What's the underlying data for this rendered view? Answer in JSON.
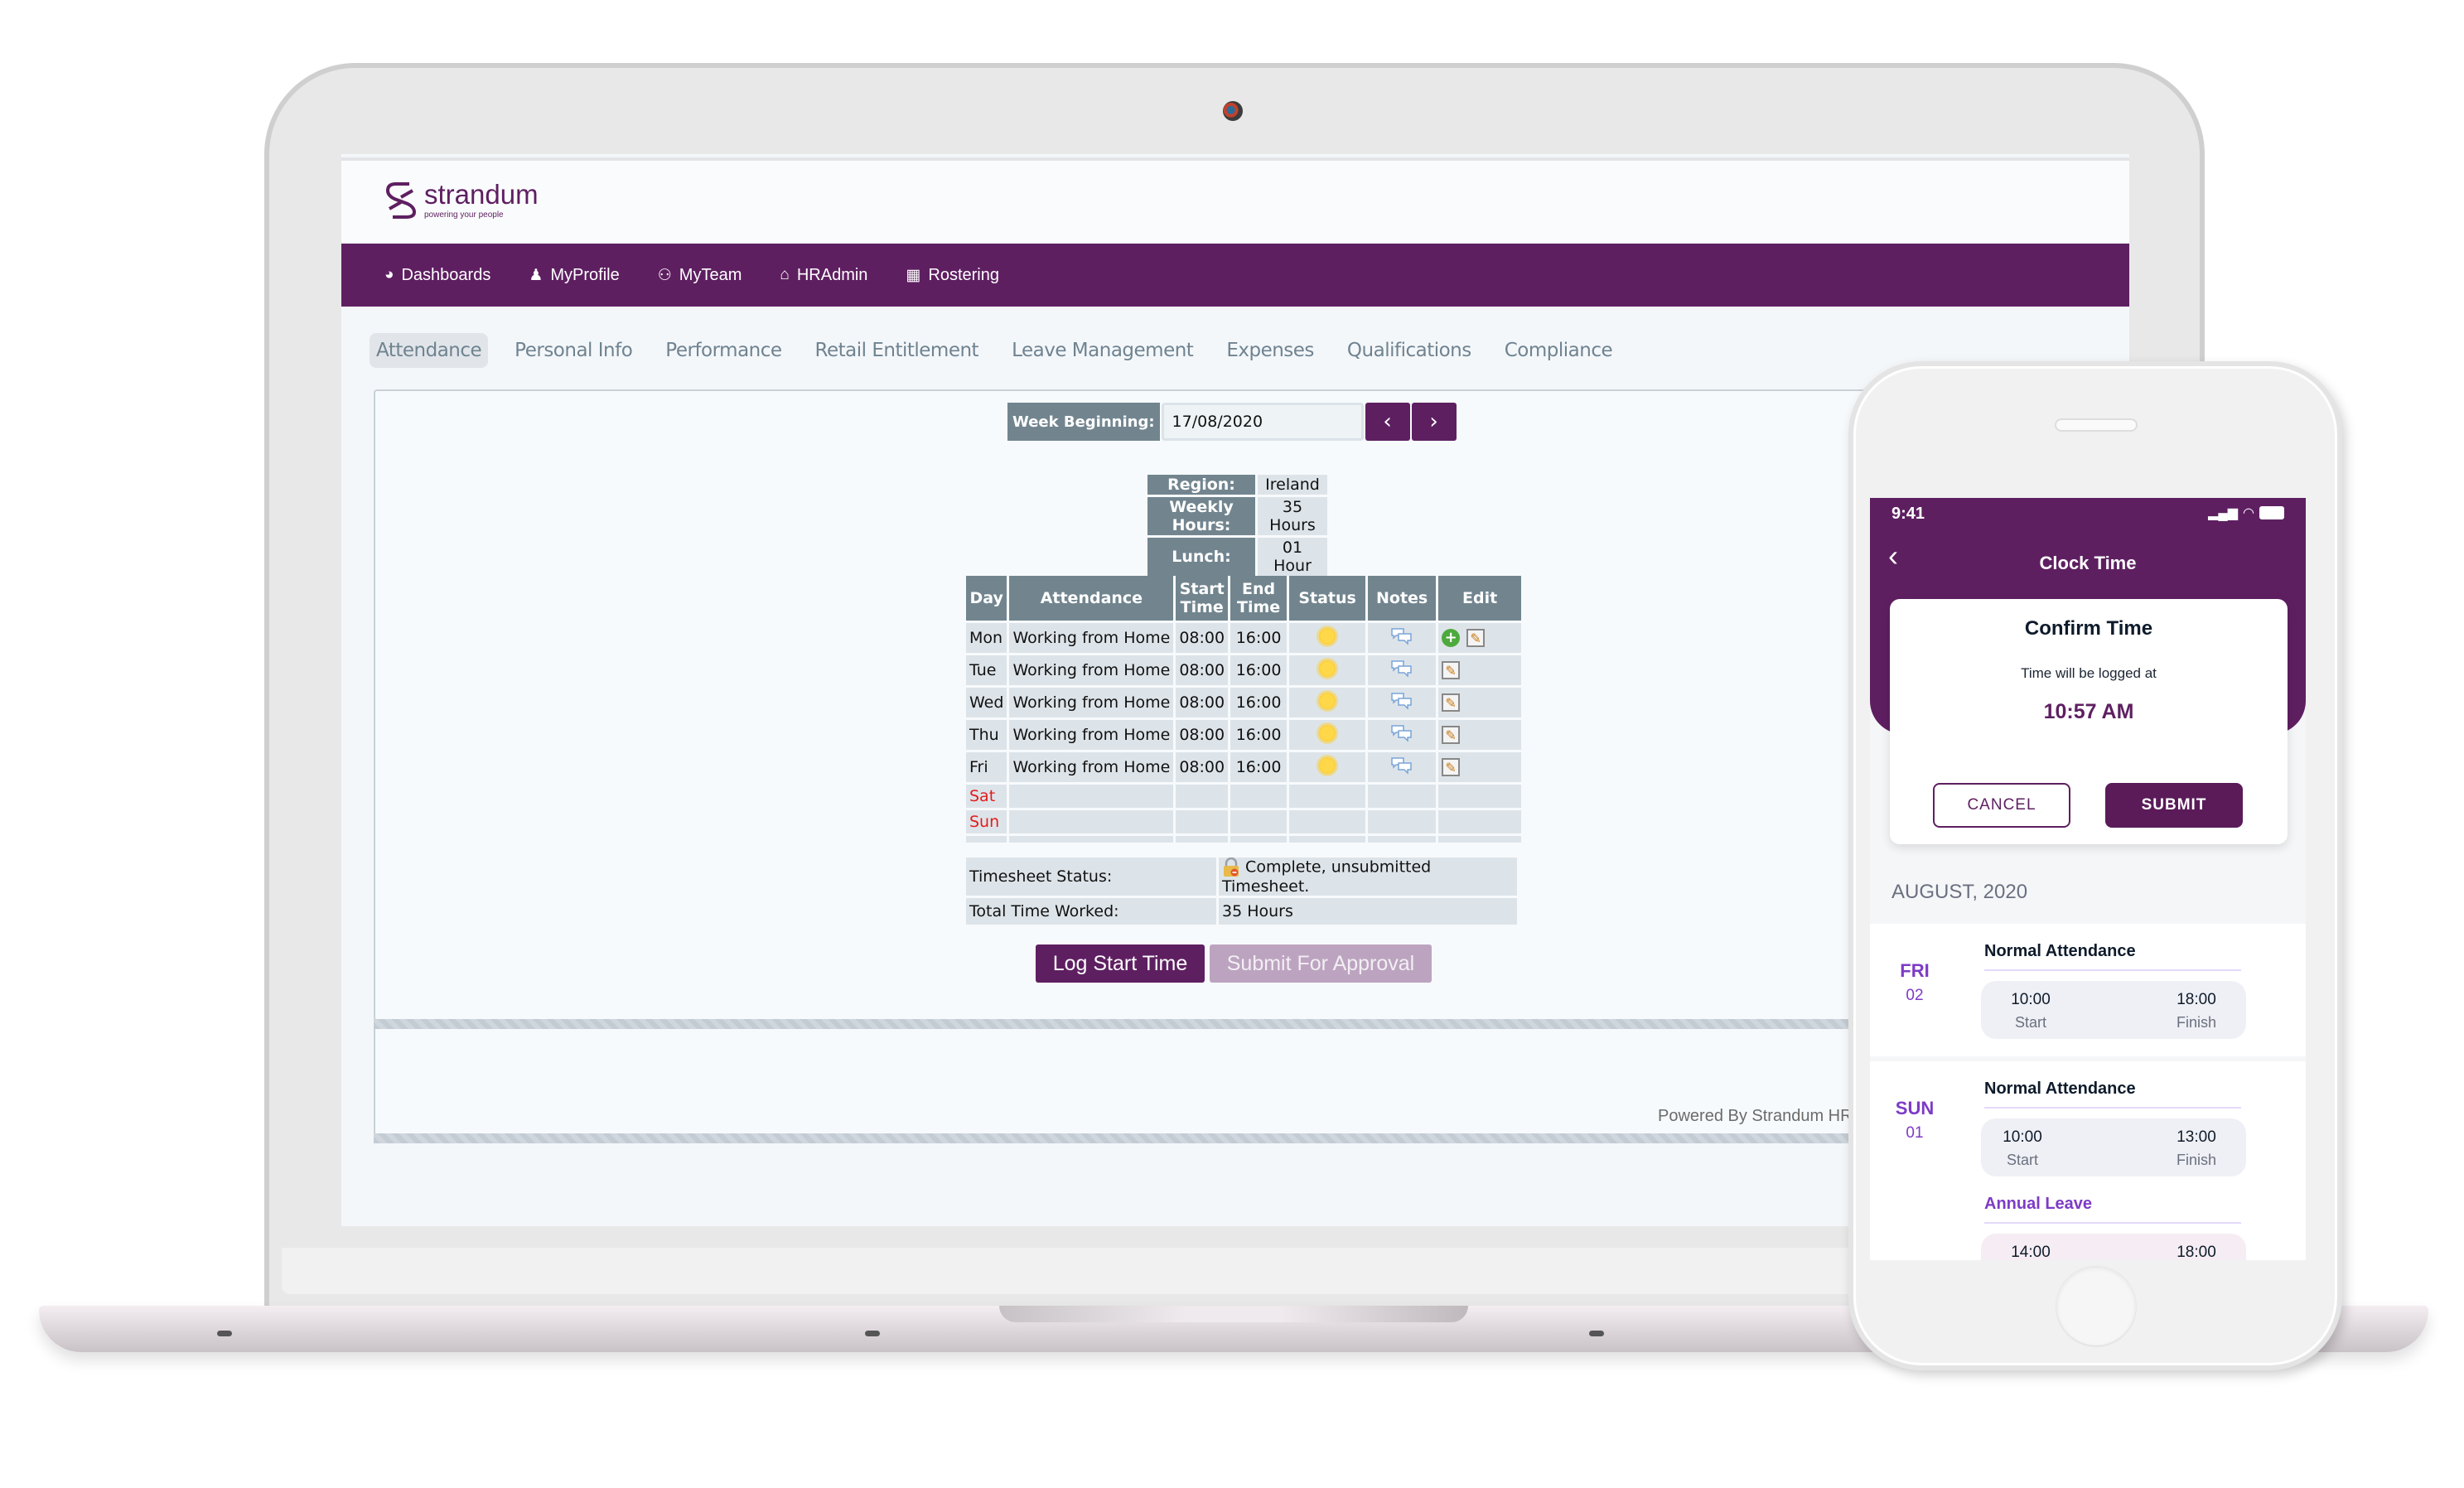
{
  "laptop": {
    "brand": {
      "name": "strandum",
      "tagline": "powering your people"
    },
    "nav": [
      {
        "label": "Dashboards",
        "icon": "dashboard-icon"
      },
      {
        "label": "MyProfile",
        "icon": "user-icon"
      },
      {
        "label": "MyTeam",
        "icon": "team-icon"
      },
      {
        "label": "HRAdmin",
        "icon": "bank-icon"
      },
      {
        "label": "Rostering",
        "icon": "calendar-icon"
      }
    ],
    "tabs": [
      {
        "label": "Attendance",
        "active": true
      },
      {
        "label": "Personal Info"
      },
      {
        "label": "Performance"
      },
      {
        "label": "Retail Entitlement"
      },
      {
        "label": "Leave Management"
      },
      {
        "label": "Expenses"
      },
      {
        "label": "Qualifications"
      },
      {
        "label": "Compliance"
      }
    ],
    "week": {
      "label": "Week Beginning:",
      "value": "17/08/2020",
      "prev": "‹",
      "next": "›"
    },
    "info": [
      {
        "key": "Region:",
        "value": "Ireland"
      },
      {
        "key": "Weekly Hours:",
        "value": "35 Hours"
      },
      {
        "key": "Lunch:",
        "value": "01 Hour"
      }
    ],
    "table": {
      "headers": [
        "Day",
        "Attendance",
        "Start Time",
        "End Time",
        "Status",
        "Notes",
        "Edit"
      ],
      "rows": [
        {
          "day": "Mon",
          "attendance": "Working from Home",
          "start": "08:00",
          "end": "16:00"
        },
        {
          "day": "Tue",
          "attendance": "Working from Home",
          "start": "08:00",
          "end": "16:00"
        },
        {
          "day": "Wed",
          "attendance": "Working from Home",
          "start": "08:00",
          "end": "16:00"
        },
        {
          "day": "Thu",
          "attendance": "Working from Home",
          "start": "08:00",
          "end": "16:00"
        },
        {
          "day": "Fri",
          "attendance": "Working from Home",
          "start": "08:00",
          "end": "16:00"
        },
        {
          "day": "Sat",
          "attendance": "",
          "start": "",
          "end": ""
        },
        {
          "day": "Sun",
          "attendance": "",
          "start": "",
          "end": ""
        }
      ]
    },
    "summary": {
      "status_label": "Timesheet Status:",
      "status_value": "Complete, unsubmitted Timesheet.",
      "total_label": "Total Time Worked:",
      "total_value": "35 Hours"
    },
    "buttons": {
      "log_start": "Log Start Time",
      "submit_approval": "Submit For Approval"
    },
    "footer": "Powered By Strandum HR"
  },
  "phone": {
    "status_time": "9:41",
    "title": "Clock Time",
    "dialog": {
      "title": "Confirm Time",
      "subtitle": "Time will be logged at",
      "time": "10:57 AM",
      "cancel": "CANCEL",
      "submit": "SUBMIT"
    },
    "month": "AUGUST, 2020",
    "entries": [
      {
        "day": "FRI",
        "date": "02",
        "blocks": [
          {
            "type": "Normal Attendance",
            "start": "10:00",
            "finish": "18:00"
          }
        ]
      },
      {
        "day": "SUN",
        "date": "01",
        "blocks": [
          {
            "type": "Normal Attendance",
            "start": "10:00",
            "finish": "13:00"
          },
          {
            "type": "Annual Leave",
            "start": "14:00",
            "finish": "18:00"
          }
        ]
      }
    ],
    "labels": {
      "start": "Start",
      "finish": "Finish"
    }
  },
  "colors": {
    "brand_purple": "#5e1f61",
    "header_slate": "#72858f",
    "cell_bg": "#dde4e9",
    "weekend_red": "#e31b1b",
    "accent_violet": "#7d3bc6"
  }
}
